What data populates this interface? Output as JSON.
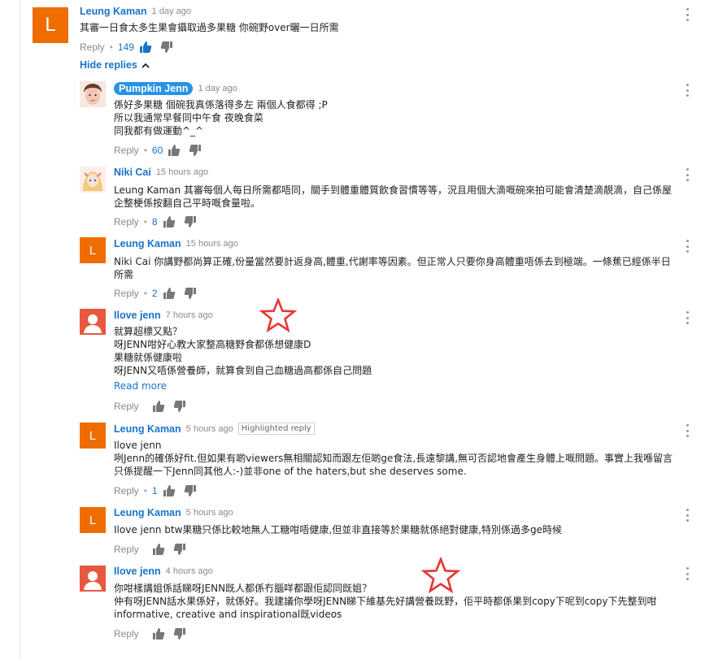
{
  "icons": {
    "like": "thumbs-up-icon",
    "dislike": "thumbs-down-icon",
    "menu": "more-vert-icon",
    "collapse": "chevron-up-icon",
    "annotation": "red-star-icon"
  },
  "colors": {
    "link": "#1a73c8",
    "avatar_orange": "#ef6c00",
    "avatar_red": "#e8573f",
    "star": "#e53935"
  },
  "top_comment": {
    "avatar_letter": "L",
    "author": "Leung Kaman",
    "time": "1 day ago",
    "text": "其審一日食太多生果會攝取過多果糖 你碗野over曬一日所需",
    "reply_label": "Reply",
    "likes": "149"
  },
  "hide_replies_label": "Hide replies",
  "replies": [
    {
      "author": "Pumpkin Jenn",
      "time": "1 day ago",
      "lines": [
        "係好多果糖 個碗我真係落得多左 兩個人食都得 ;P",
        "所以我通常早餐同中午食 夜晚食菜",
        "同我都有做運動^_^"
      ],
      "reply_label": "Reply",
      "likes": "60"
    },
    {
      "author": "Niki Cai",
      "time": "15 hours ago",
      "lines": [
        "Leung Kaman 其審每個人每日所需都唔同，關手到體重體質飲食習慣等等，況且用個大滴嘅碗來拍可能會清楚滴靚滴，自己係屋企整梗係按翻自己平時嘅食量啦。"
      ],
      "reply_label": "Reply",
      "likes": "8"
    },
    {
      "avatar_letter": "L",
      "author": "Leung Kaman",
      "time": "15 hours ago",
      "lines": [
        "Niki Cai 你講野都尚算正確,份量當然要計返身高,體重,代謝率等因素。但正常人只要你身高體重唔係去到極端。一條蕉已經係半日所需"
      ],
      "reply_label": "Reply",
      "likes": "2"
    },
    {
      "author": "Ilove jenn",
      "time": "7 hours ago",
      "lines": [
        "就算超標又點？",
        "呀JENN咁好心教大家整高糖野食都係想健康D",
        "果糖就係健康啦",
        "呀JENN又唔係營養師，就算食到自己血糖過高都係自己問題"
      ],
      "read_more": "Read more",
      "reply_label": "Reply"
    },
    {
      "avatar_letter": "L",
      "author": "Leung Kaman",
      "time": "5 hours ago",
      "badge": "Highlighted reply",
      "lines": [
        "Ilove jenn",
        "咧Jenn的確係好fit.但如果有啲viewers無相關認知而跟左佢啲ge食法,長遠黎講,無可否認地會產生身體上嘅問題。事實上我喺留言只係提醒一下Jenn同其他人:-)並非one of the haters,but she deserves some."
      ],
      "reply_label": "Reply",
      "likes": "1"
    },
    {
      "avatar_letter": "L",
      "author": "Leung Kaman",
      "time": "5 hours ago",
      "lines": [
        "Ilove jenn btw果糖只係比較地無人工糖咁唔健康,但並非直接等於果糖就係絕對健康,特別係過多ge時候"
      ],
      "reply_label": "Reply"
    },
    {
      "author": "Ilove jenn",
      "time": "4 hours ago",
      "lines": [
        "你咁樣講姐係話睇呀JENN既人都係冇腦咩都跟佢認同既姐？",
        "仲有呀JENN話水果係好，就係好。我建議你學呀JENN睇下維基先好講營養既野，佢平時都係果到copy下呢到copy下先整到咁informative, creative and inspirational既videos"
      ],
      "reply_label": "Reply"
    }
  ]
}
